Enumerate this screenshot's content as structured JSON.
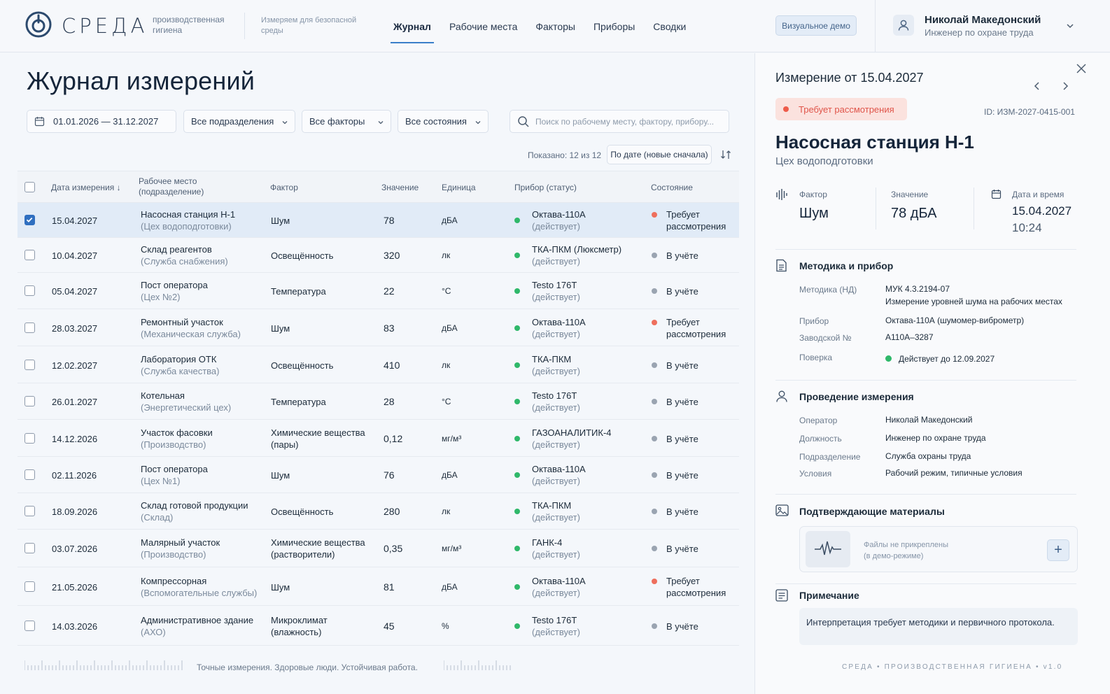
{
  "brand": {
    "name": "СРЕДА",
    "tagline": "производственная гигиена",
    "slogan": "Измеряем для безопасной среды"
  },
  "nav": {
    "items": [
      {
        "label": "Журнал",
        "active": true
      },
      {
        "label": "Рабочие места"
      },
      {
        "label": "Факторы"
      },
      {
        "label": "Приборы"
      },
      {
        "label": "Сводки"
      }
    ]
  },
  "header": {
    "demo_label": "Визуальное демо",
    "user_name": "Николай Македонский",
    "user_role": "Инженер по охране труда"
  },
  "page": {
    "title": "Журнал измерений"
  },
  "filters": {
    "date_range": "01.01.2026 — 31.12.2027",
    "department": "Все подразделения",
    "factor": "Все факторы",
    "state": "Все состояния",
    "search_placeholder": "Поиск по рабочему месту, фактору, прибору..."
  },
  "list": {
    "shown": "Показано: 12 из 12",
    "sort": "По дате (новые сначала)"
  },
  "table": {
    "headers": {
      "date": "Дата измерения",
      "workplace": "Рабочее место",
      "workplace_sub": "(подразделение)",
      "factor": "Фактор",
      "value": "Значение",
      "unit": "Единица",
      "device": "Прибор (статус)",
      "state": "Состояние"
    },
    "rows": [
      {
        "date": "15.04.2027",
        "place": "Насосная станция Н-1",
        "dept": "(Цех водоподготовки)",
        "factor": "Шум",
        "factor2": "",
        "value": "78",
        "unit": "дБА",
        "device": "Октава-110А",
        "device_status": "(действует)",
        "state": "Требует",
        "state2": "рассмотрения",
        "alert": true,
        "checked": true
      },
      {
        "date": "10.04.2027",
        "place": "Склад реагентов",
        "dept": "(Служба снабжения)",
        "factor": "Освещённость",
        "factor2": "",
        "value": "320",
        "unit": "лк",
        "device": "ТКА-ПКМ (Люксметр)",
        "device_status": "(действует)",
        "state": "В учёте",
        "state2": "",
        "alert": false,
        "checked": false
      },
      {
        "date": "05.04.2027",
        "place": "Пост оператора",
        "dept": "(Цех №2)",
        "factor": "Температура",
        "factor2": "",
        "value": "22",
        "unit": "°C",
        "device": "Testo 176T",
        "device_status": "(действует)",
        "state": "В учёте",
        "state2": "",
        "alert": false,
        "checked": false
      },
      {
        "date": "28.03.2027",
        "place": "Ремонтный участок",
        "dept": "(Механическая служба)",
        "factor": "Шум",
        "factor2": "",
        "value": "83",
        "unit": "дБА",
        "device": "Октава-110А",
        "device_status": "(действует)",
        "state": "Требует",
        "state2": "рассмотрения",
        "alert": true,
        "checked": false
      },
      {
        "date": "12.02.2027",
        "place": "Лаборатория ОТК",
        "dept": "(Служба качества)",
        "factor": "Освещённость",
        "factor2": "",
        "value": "410",
        "unit": "лк",
        "device": "ТКА-ПКМ",
        "device_status": "(действует)",
        "state": "В учёте",
        "state2": "",
        "alert": false,
        "checked": false
      },
      {
        "date": "26.01.2027",
        "place": "Котельная",
        "dept": "(Энергетический цех)",
        "factor": "Температура",
        "factor2": "",
        "value": "28",
        "unit": "°C",
        "device": "Testo 176T",
        "device_status": "(действует)",
        "state": "В учёте",
        "state2": "",
        "alert": false,
        "checked": false
      },
      {
        "date": "14.12.2026",
        "place": "Участок фасовки",
        "dept": "(Производство)",
        "factor": "Химические вещества",
        "factor2": "(пары)",
        "value": "0,12",
        "unit": "мг/м³",
        "device": "ГАЗОАНАЛИТИК-4",
        "device_status": "(действует)",
        "state": "В учёте",
        "state2": "",
        "alert": false,
        "checked": false
      },
      {
        "date": "02.11.2026",
        "place": "Пост оператора",
        "dept": "(Цех №1)",
        "factor": "Шум",
        "factor2": "",
        "value": "76",
        "unit": "дБА",
        "device": "Октава-110А",
        "device_status": "(действует)",
        "state": "В учёте",
        "state2": "",
        "alert": false,
        "checked": false
      },
      {
        "date": "18.09.2026",
        "place": "Склад готовой продукции",
        "dept": "(Склад)",
        "factor": "Освещённость",
        "factor2": "",
        "value": "280",
        "unit": "лк",
        "device": "ТКА-ПКМ",
        "device_status": "(действует)",
        "state": "В учёте",
        "state2": "",
        "alert": false,
        "checked": false
      },
      {
        "date": "03.07.2026",
        "place": "Малярный участок",
        "dept": "(Производство)",
        "factor": "Химические вещества",
        "factor2": "(растворители)",
        "value": "0,35",
        "unit": "мг/м³",
        "device": "ГАНК-4",
        "device_status": "(действует)",
        "state": "В учёте",
        "state2": "",
        "alert": false,
        "checked": false
      },
      {
        "date": "21.05.2026",
        "place": "Компрессорная",
        "dept": "(Вспомогательные службы)",
        "factor": "Шум",
        "factor2": "",
        "value": "81",
        "unit": "дБА",
        "device": "Октава-110А",
        "device_status": "(действует)",
        "state": "Требует",
        "state2": "рассмотрения",
        "alert": true,
        "checked": false
      },
      {
        "date": "14.03.2026",
        "place": "Административное здание",
        "dept": "(АХО)",
        "factor": "Микроклимат",
        "factor2": "(влажность)",
        "value": "45",
        "unit": "%",
        "device": "Testo 176T",
        "device_status": "(действует)",
        "state": "В учёте",
        "state2": "",
        "alert": false,
        "checked": false
      }
    ]
  },
  "footer": {
    "slogan": "Точные измерения. Здоровые люди. Устойчивая работа."
  },
  "panel": {
    "title": "Измерение от 15.04.2027",
    "status": "Требует рассмотрения",
    "id": "ID: ИЗМ-2027-0415-001",
    "name": "Насосная станция Н-1",
    "dept": "Цех водоподготовки",
    "kpi": {
      "factor_label": "Фактор",
      "factor": "Шум",
      "value_label": "Значение",
      "value": "78 дБА",
      "dt_label": "Дата и время",
      "date": "15.04.2027",
      "time": "10:24"
    },
    "method": {
      "title": "Методика и прибор",
      "method_k": "Методика (НД)",
      "method_v": "МУК 4.3.2194-07",
      "method_v2": "Измерение уровней шума на рабочих местах",
      "device_k": "Прибор",
      "device_v": "Октава-110А (шумомер-виброметр)",
      "serial_k": "Заводской №",
      "serial_v": "А110А–3287",
      "verif_k": "Поверка",
      "verif_v": "Действует до 12.09.2027"
    },
    "conduct": {
      "title": "Проведение измерения",
      "op_k": "Оператор",
      "op_v": "Николай Македонский",
      "pos_k": "Должность",
      "pos_v": "Инженер по охране труда",
      "dep_k": "Подразделение",
      "dep_v": "Служба охраны труда",
      "cond_k": "Условия",
      "cond_v": "Рабочий режим, типичные условия"
    },
    "files": {
      "title": "Подтверждающие материалы",
      "empty": "Файлы не прикреплены",
      "empty2": "(в демо-режиме)"
    },
    "note": {
      "title": "Примечание",
      "text": "Интерпретация требует методики и первичного протокола."
    },
    "footer": "СРЕДА • ПРОИЗВОДСТВЕННАЯ ГИГИЕНА • v1.0"
  },
  "colors": {
    "accent": "#2f6fc0",
    "ok": "#2fb86a",
    "alert": "#ee6f5d",
    "neutral": "#9aa4b1"
  }
}
